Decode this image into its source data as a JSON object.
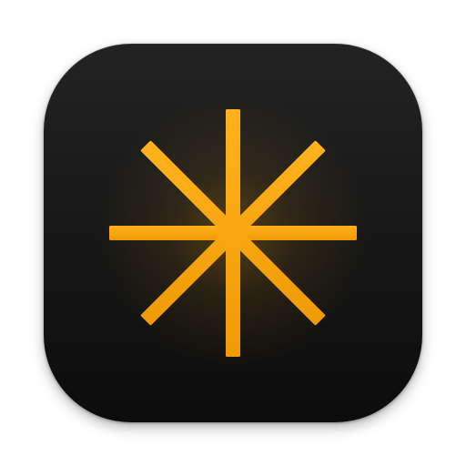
{
  "icon": {
    "name": "asterisk-icon",
    "background_color": "#161616",
    "accent_color": "#F5A40C",
    "accent_highlight": "#FFC13A",
    "glow_color": "#F5A40C"
  }
}
